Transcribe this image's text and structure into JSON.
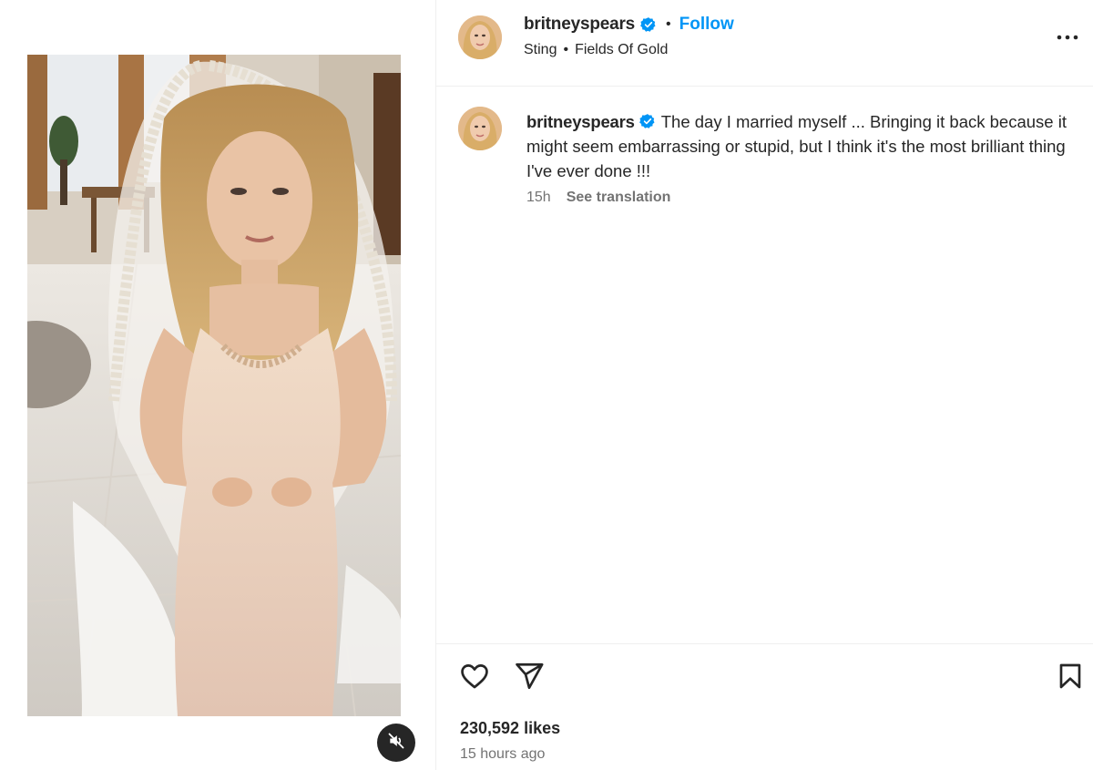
{
  "post": {
    "username": "britneyspears",
    "verified": true,
    "follow_label": "Follow",
    "audio": {
      "artist": "Sting",
      "track": "Fields Of Gold"
    },
    "caption_text": "The day I married myself ... Bringing it back because it might seem embarrassing or stupid, but I think it's the most brilliant thing I've ever done !!!",
    "relative_time": "15h",
    "see_translation_label": "See translation",
    "likes_text": "230,592 likes",
    "time_ago": "15 hours ago",
    "media": {
      "type": "video",
      "muted": true
    }
  },
  "colors": {
    "accent": "#0095f6",
    "text_primary": "#262626",
    "text_secondary": "#737373",
    "divider": "#efefef",
    "verified_badge": "#0095f6"
  },
  "icons": {
    "more": "more-horizontal-icon",
    "like": "heart-icon",
    "share": "send-icon",
    "save": "bookmark-icon",
    "mute": "speaker-muted-icon",
    "verified": "verified-badge-icon"
  }
}
